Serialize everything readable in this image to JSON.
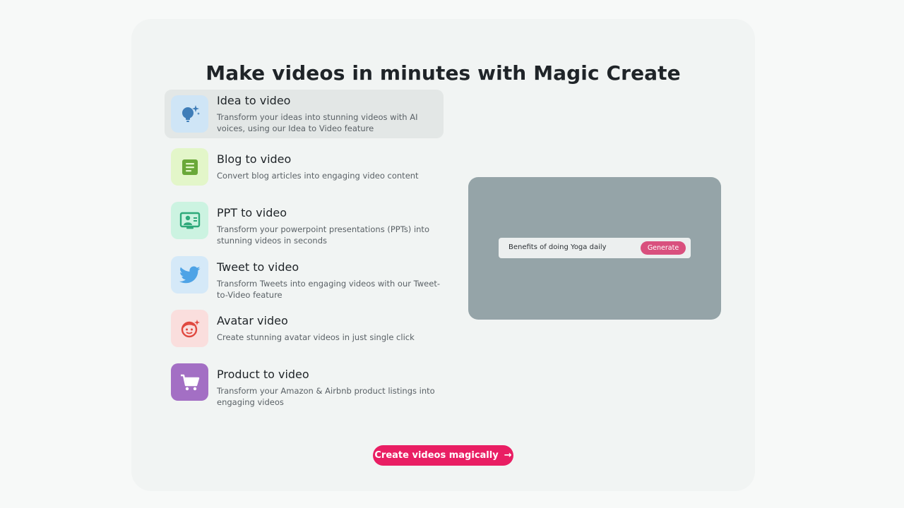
{
  "heading": "Make videos in minutes with Magic Create",
  "features": [
    {
      "title": "Idea to video",
      "description": "Transform your ideas into stunning videos with AI voices, using our Idea to Video feature",
      "icon": "lightbulb-sparkle-icon",
      "icon_bg": "#cfe5f6",
      "icon_color": "#3f7db8",
      "active": true
    },
    {
      "title": "Blog to video",
      "description": "Convert blog articles into engaging video content",
      "icon": "document-icon",
      "icon_bg": "#e3f6c9",
      "icon_color": "#6aa839"
    },
    {
      "title": "PPT to video",
      "description": "Transform your powerpoint presentations (PPTs) into stunning videos in seconds",
      "icon": "presentation-icon",
      "icon_bg": "#ccf3e1",
      "icon_color": "#2ea97a"
    },
    {
      "title": "Tweet to video",
      "description": "Transform Tweets into engaging videos with our Tweet-to-Video feature",
      "icon": "twitter-bird-icon",
      "icon_bg": "#d5e9f8",
      "icon_color": "#4ea3e6"
    },
    {
      "title": "Avatar video",
      "description": "Create stunning avatar videos in just single click",
      "icon": "avatar-face-icon",
      "icon_bg": "#fadedd",
      "icon_color": "#e0483f"
    },
    {
      "title": "Product to video",
      "description": "Transform your Amazon & Airbnb product listings into engaging videos",
      "icon": "shopping-cart-icon",
      "icon_bg": "#a36fc4",
      "icon_color": "#ffffff"
    }
  ],
  "preview": {
    "prompt_text": "Benefits of doing Yoga daily",
    "generate_label": "Generate"
  },
  "cta": {
    "label": "Create videos magically",
    "arrow": "→"
  },
  "colors": {
    "accent": "#e91e63",
    "generate": "#d9507e",
    "preview_bg": "#95a4a8"
  }
}
